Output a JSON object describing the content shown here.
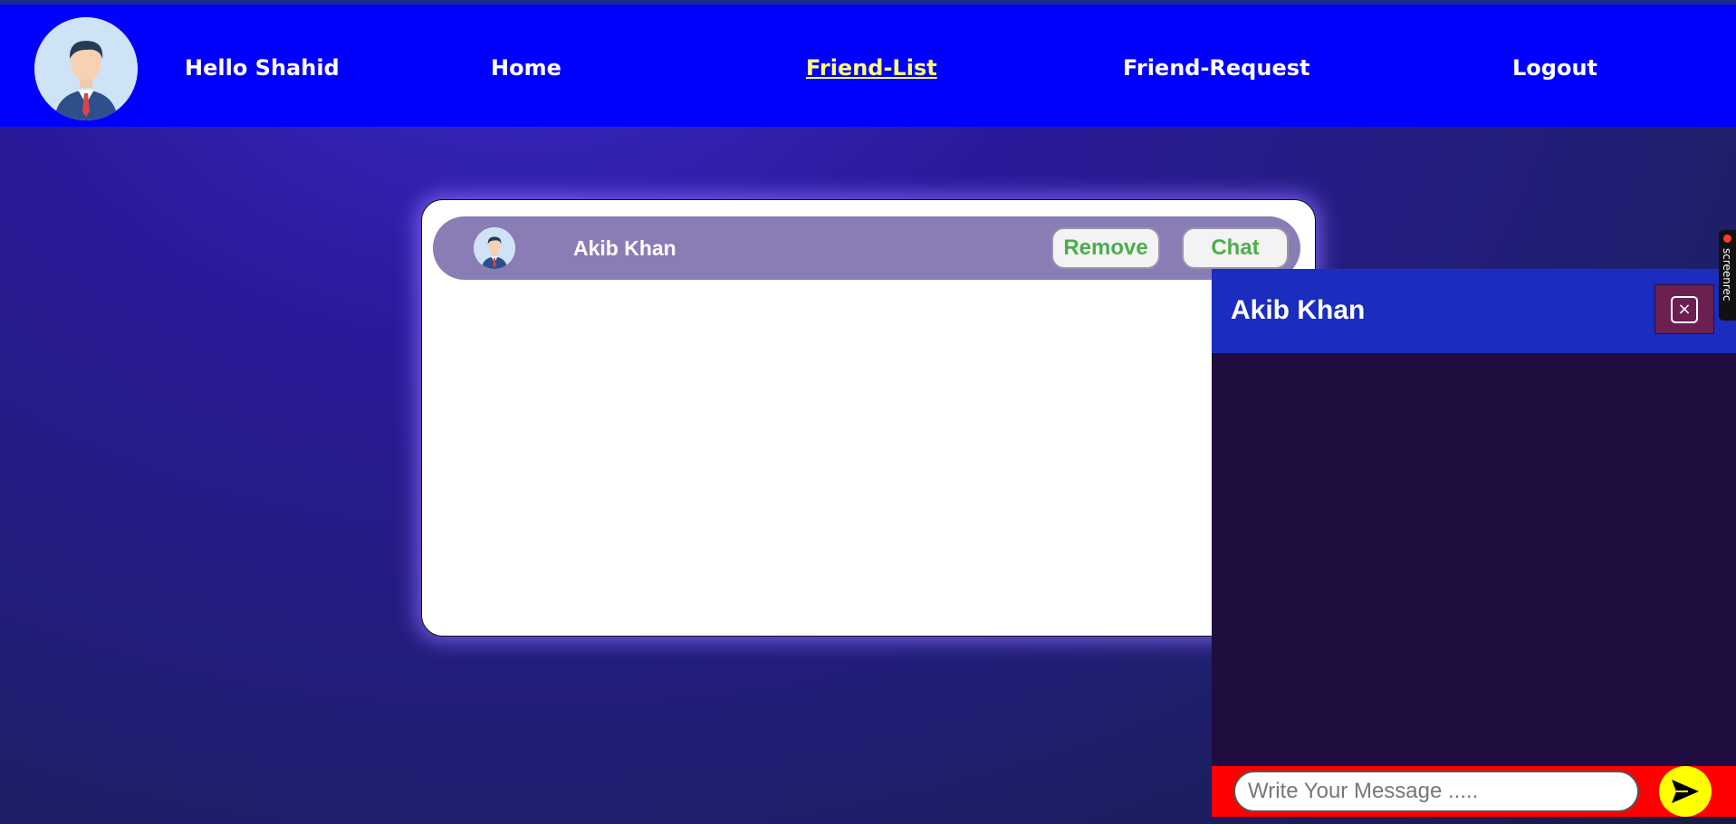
{
  "navbar": {
    "greeting": "Hello Shahid",
    "items": [
      {
        "label": "Home",
        "active": false
      },
      {
        "label": "Friend-List",
        "active": true
      },
      {
        "label": "Friend-Request",
        "active": false
      },
      {
        "label": "Logout",
        "active": false
      }
    ]
  },
  "friends": [
    {
      "name": "Akib Khan",
      "remove_label": "Remove",
      "chat_label": "Chat"
    }
  ],
  "chat": {
    "title": "Akib Khan",
    "close_glyph": "×",
    "input_placeholder": "Write Your Message .....",
    "input_value": ""
  },
  "recorder": {
    "label": "screenrec"
  },
  "colors": {
    "navbar_bg": "#0000ff",
    "active_link": "#ffff7a",
    "friend_row_bg": "#8a7db6",
    "action_text": "#4cae4c",
    "chat_header_bg": "#1a2dbf",
    "chat_body_bg": "#1f0d3f",
    "chat_footer_bg": "#ff0000",
    "send_button_bg": "#ffff00"
  }
}
